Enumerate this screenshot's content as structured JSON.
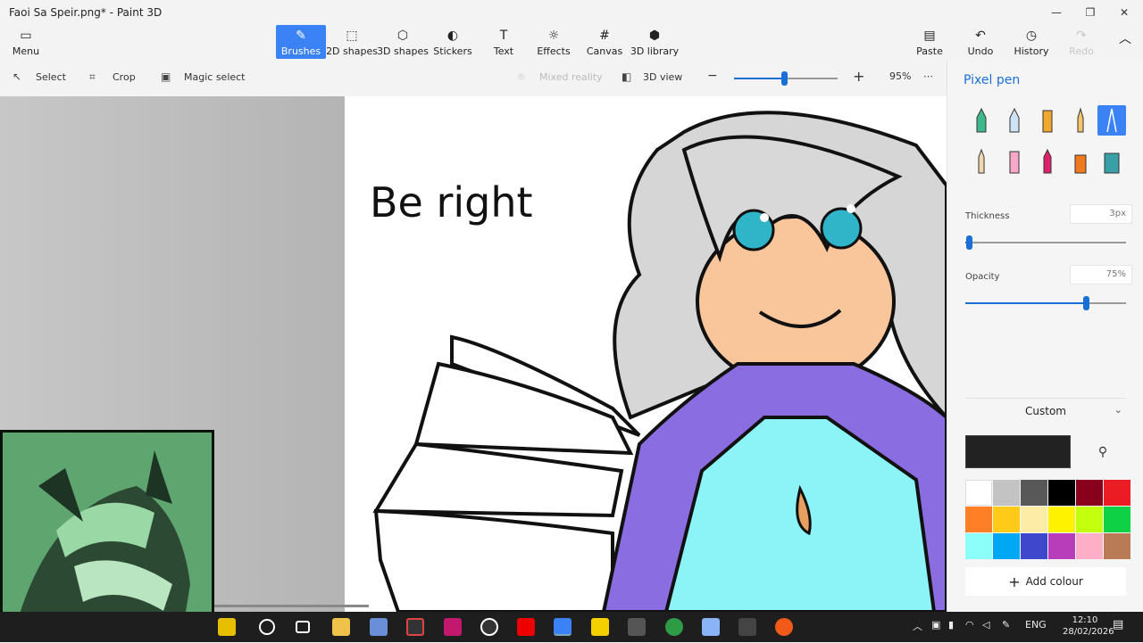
{
  "window": {
    "title": "Faoi Sa Speir.png* - Paint 3D",
    "controls": [
      "—",
      "❐",
      "✕"
    ]
  },
  "ribbon": {
    "menu": "Menu",
    "tabs": [
      "Brushes",
      "2D shapes",
      "3D shapes",
      "Stickers",
      "Text",
      "Effects",
      "Canvas",
      "3D library"
    ],
    "active_tab": "Brushes",
    "paste": "Paste",
    "undo": "Undo",
    "history": "History",
    "redo": "Redo"
  },
  "toolbar": {
    "select": "Select",
    "crop": "Crop",
    "magic_select": "Magic select",
    "mixed_reality": "Mixed reality",
    "view_3d": "3D view",
    "zoom": "95%"
  },
  "canvas": {
    "handwriting": "Be right"
  },
  "side_panel": {
    "title": "Pixel pen",
    "thickness_label": "Thickness",
    "thickness_value": "3px",
    "thickness_fraction": 0.02,
    "opacity_label": "Opacity",
    "opacity_value": "75%",
    "opacity_fraction": 0.75,
    "colour_mode": "Custom",
    "current_colour": "#222222",
    "palette": [
      "#ffffff",
      "#c3c3c3",
      "#585858",
      "#000000",
      "#88001b",
      "#ec1c24",
      "#ff7f27",
      "#ffca18",
      "#fdeca6",
      "#fff200",
      "#c4ff0e",
      "#0ed145",
      "#8cfffb",
      "#00a8f3",
      "#3f48cc",
      "#b83dba",
      "#ffaec8",
      "#b97a56"
    ],
    "add_colour": "Add colour"
  },
  "taskbar": {
    "language": "ENG",
    "time": "12:10",
    "date": "28/02/2026"
  }
}
